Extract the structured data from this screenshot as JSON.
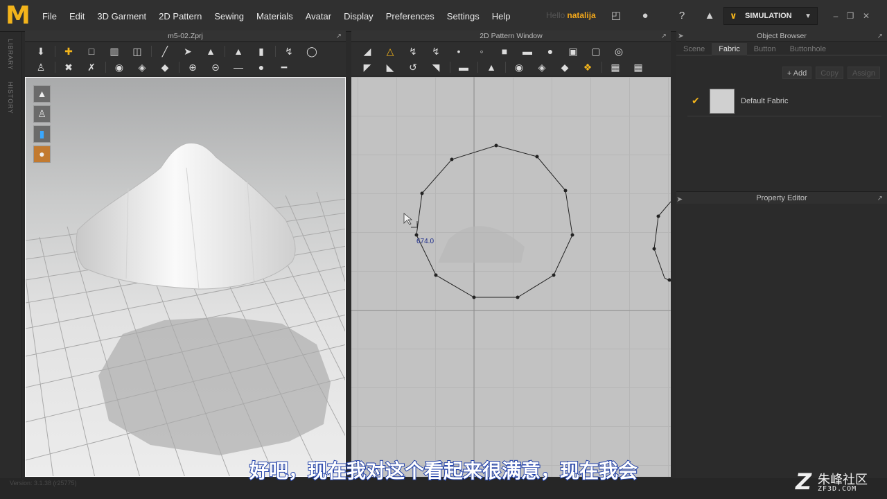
{
  "app": {
    "logo": "M"
  },
  "menu": [
    "File",
    "Edit",
    "3D Garment",
    "2D Pattern",
    "Sewing",
    "Materials",
    "Avatar",
    "Display",
    "Preferences",
    "Settings",
    "Help"
  ],
  "user": {
    "greeting": "Hello",
    "name": "natalija"
  },
  "simulation": {
    "label": "SIMULATION"
  },
  "side_tabs": [
    "LIBRARY",
    "HISTORY"
  ],
  "viewport3d": {
    "title": "m5-02.Zprj"
  },
  "viewport2d": {
    "title": "2D Pattern Window",
    "measurement": "674.0"
  },
  "object_browser": {
    "title": "Object Browser",
    "tabs": [
      "Scene",
      "Fabric",
      "Button",
      "Buttonhole"
    ],
    "actions": {
      "add": "+ Add",
      "copy": "Copy",
      "assign": "Assign"
    },
    "fabric_name": "Default Fabric"
  },
  "property_editor": {
    "title": "Property Editor"
  },
  "footer": {
    "version": "Version: 3.1.38 (r25775)"
  },
  "subtitle": "好吧，现在我对这个看起来很满意，现在我会",
  "watermark": {
    "cn": "朱峰社区",
    "url": "ZF3D.COM"
  },
  "colors": {
    "accent": "#f3b41b",
    "bg": "#2b2b2b"
  }
}
